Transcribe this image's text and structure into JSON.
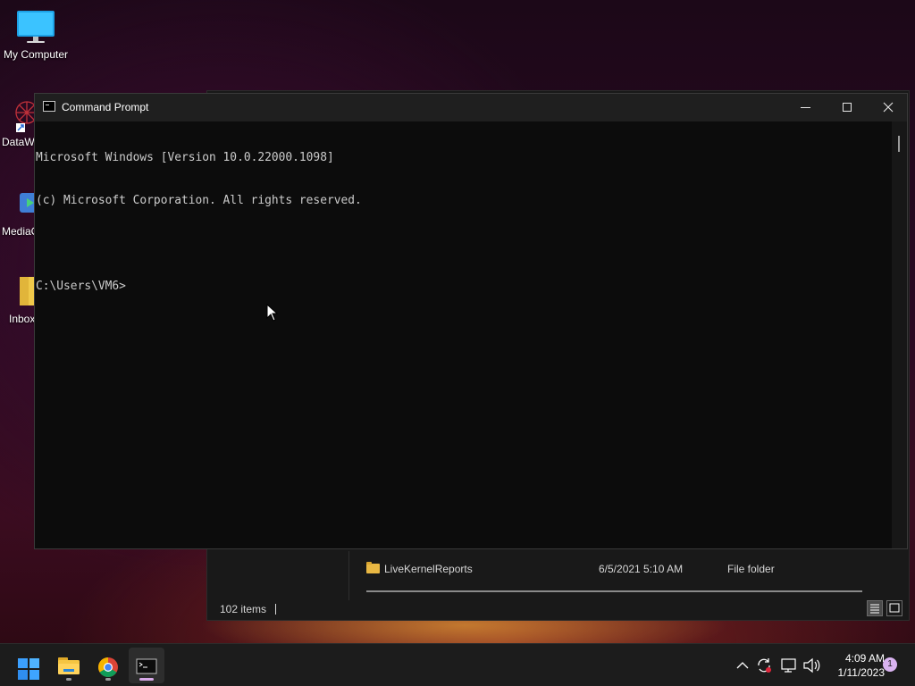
{
  "desktop": {
    "icons": [
      {
        "label": "My Computer"
      },
      {
        "label": "DataW"
      },
      {
        "label": "MediaC"
      },
      {
        "label": "Inbox"
      }
    ]
  },
  "cmd_window": {
    "title": "Command Prompt",
    "lines": [
      "Microsoft Windows [Version 10.0.22000.1098]",
      "(c) Microsoft Corporation. All rights reserved.",
      "",
      "C:\\Users\\VM6>"
    ],
    "controls": {
      "minimize": "minimize",
      "maximize": "maximize",
      "close": "close"
    }
  },
  "explorer_window": {
    "row": {
      "name": "LiveKernelReports",
      "date": "6/5/2021 5:10 AM",
      "type": "File folder"
    },
    "status": "102 items"
  },
  "taskbar": {
    "apps": [
      {
        "name": "Start",
        "icon": "windows-start-icon"
      },
      {
        "name": "File Explorer",
        "icon": "file-explorer-icon"
      },
      {
        "name": "Google Chrome",
        "icon": "chrome-icon"
      },
      {
        "name": "Command Prompt",
        "icon": "terminal-icon"
      }
    ],
    "time": "4:09 AM",
    "date": "1/11/2023",
    "notification_count": "1"
  },
  "colors": {
    "console_bg": "#0c0c0c",
    "console_text": "#cccccc",
    "titlebar": "#1f1f1f",
    "taskbar": "#1c1c1c",
    "accent": "#d7a9e8"
  }
}
